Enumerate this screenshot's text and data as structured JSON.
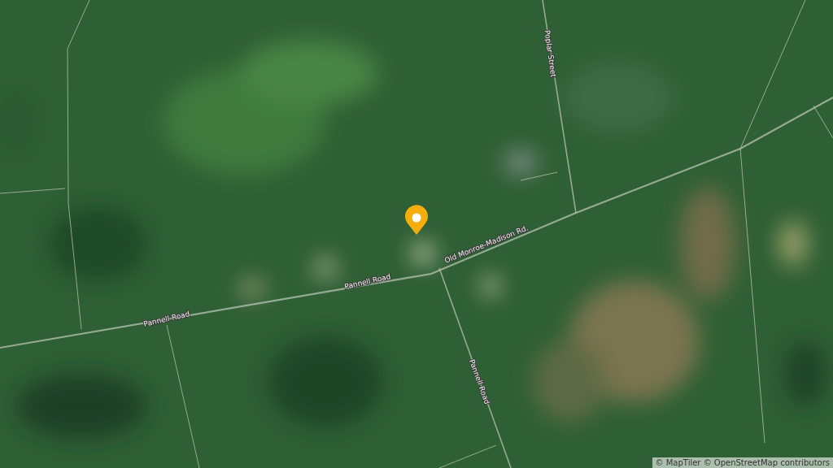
{
  "map": {
    "road_labels": [
      {
        "text": "Pannell Road"
      },
      {
        "text": "Pannell Road"
      },
      {
        "text": "Old Monroe-Madison Rd."
      },
      {
        "text": "Poplar Street"
      },
      {
        "text": "Pannell Road"
      }
    ],
    "attribution": "© MapTiler © OpenStreetMap contributors"
  }
}
